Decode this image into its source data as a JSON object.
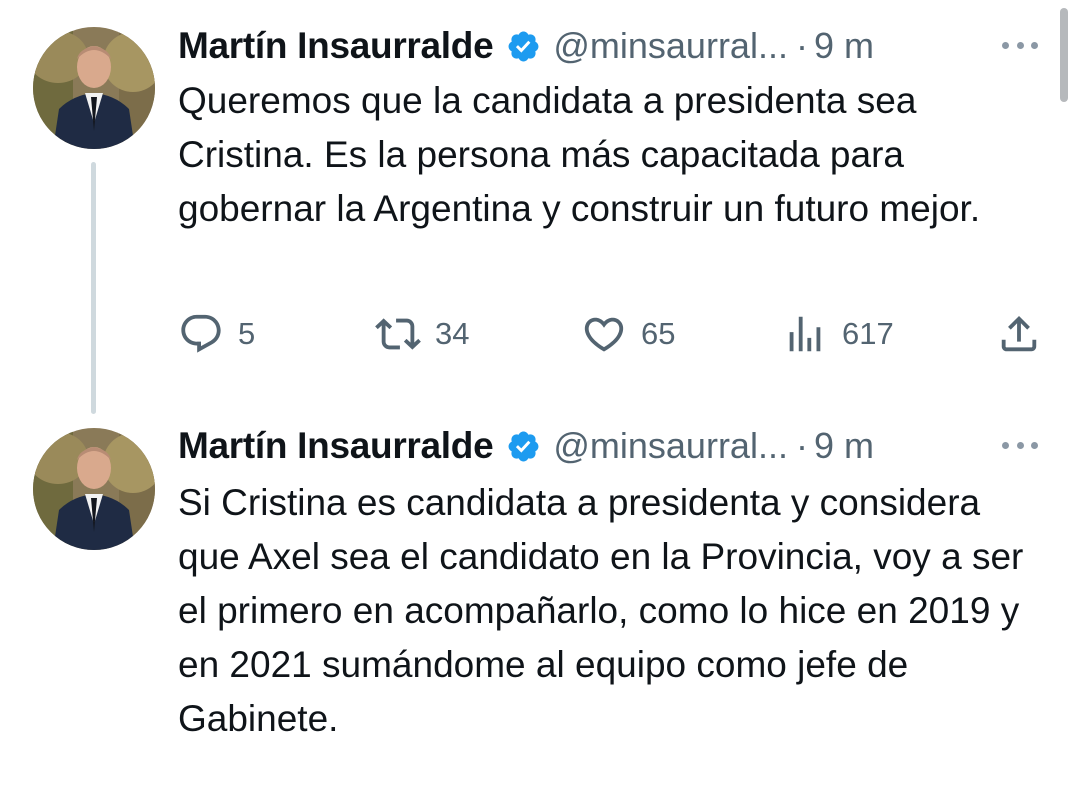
{
  "tweets": [
    {
      "author": {
        "name": "Martín Insaurralde",
        "handle": "@minsaurral...",
        "verified_icon": "verified-badge-icon",
        "verified_color": "#1d9bf0"
      },
      "separator": "·",
      "time": "9 m",
      "text": "Queremos que la candidata a presidenta sea Cristina. Es la persona más capacitada para gobernar la Argentina y construir un futuro mejor.",
      "actions": {
        "replies": "5",
        "retweets": "34",
        "likes": "65",
        "views": "617"
      }
    },
    {
      "author": {
        "name": "Martín Insaurralde",
        "handle": "@minsaurral...",
        "verified_icon": "verified-badge-icon",
        "verified_color": "#1d9bf0"
      },
      "separator": "·",
      "time": "9 m",
      "text": "Si Cristina es candidata a presidenta y considera que Axel sea el candidato en la Provincia, voy a ser el primero en acompañarlo, como lo hice en 2019 y en 2021 sumándome al equipo como jefe de Gabinete."
    }
  ],
  "icons": {
    "reply": "reply-icon",
    "retweet": "retweet-icon",
    "like": "heart-icon",
    "views": "views-icon",
    "share": "share-icon",
    "more": "more-icon"
  },
  "colors": {
    "text": "#0f1419",
    "secondary": "#536471",
    "thread_line": "#cfd9de",
    "verified": "#1d9bf0"
  }
}
